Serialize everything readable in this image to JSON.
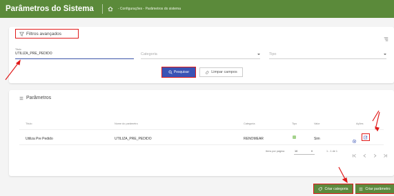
{
  "colors": {
    "topbar": "#5b8a3a",
    "primary": "#3a53b5",
    "accent_green": "#5c8a3e",
    "annotation": "#e01919",
    "tipo_badge": "#a4d28c"
  },
  "header": {
    "title": "Parâmetros do Sistema",
    "home_icon": "home-icon",
    "breadcrumb": "- Configurações - Parâmetros do sistema"
  },
  "filters": {
    "title": "Filtros avançados",
    "filter_icon": "filter-icon",
    "collapse_icon": "collapse-filter-icon",
    "titulo_label": "Título",
    "titulo_value": "UTILIZA_PRE_PEDIDO",
    "categoria_placeholder": "Categoria",
    "tipo_placeholder": "Tipo",
    "search_label": "Pesquisar",
    "clear_label": "Limpar campos"
  },
  "params": {
    "title": "Parâmetros",
    "columns": [
      "Título",
      "Nome do parâmetro",
      "Categoria",
      "Tipo",
      "Valor",
      "Ações"
    ],
    "rows": [
      {
        "titulo": "Utiliza Pre Pedido",
        "nome": "UTILIZA_PRE_PEDIDO",
        "categoria": "RENOMEAR",
        "tipo_icon": "boolean-type-icon",
        "valor": "Sim"
      }
    ],
    "pagination": {
      "items_per_page_label": "Itens por página",
      "items_per_page": "10",
      "range": "1 - 1 de 1"
    }
  },
  "actions": {
    "create_category": "Criar categoria",
    "create_param": "Criar parâmetro"
  }
}
